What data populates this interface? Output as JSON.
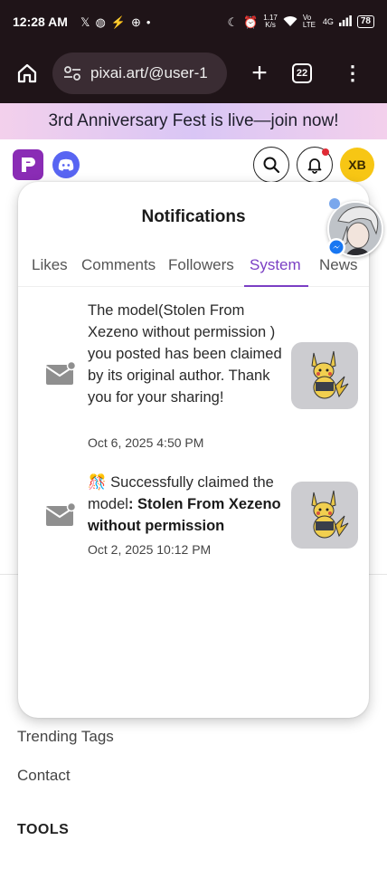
{
  "status_bar": {
    "time": "12:28 AM",
    "left_icons": [
      "x-app-icon",
      "messenger-icon",
      "signal-boost-icon",
      "dnd-icon",
      "dot-icon"
    ],
    "network_speed_top": "1.17",
    "network_speed_bottom": "K/s",
    "lte_label": "Vo LTE",
    "network_type": "4G",
    "battery": "78"
  },
  "browser": {
    "url": "pixai.art/@user-1",
    "tab_count": "22"
  },
  "banner": {
    "text": "3rd Anniversary Fest is live—join now!"
  },
  "header": {
    "avatar_initials": "XB",
    "brand_color": "#8a2cb5",
    "discord_color": "#5865f2"
  },
  "notifications": {
    "title": "Notifications",
    "tabs": [
      {
        "label": "Likes"
      },
      {
        "label": "Comments"
      },
      {
        "label": "Followers"
      },
      {
        "label": "System"
      },
      {
        "label": "News"
      }
    ],
    "active_tab": "System",
    "items": [
      {
        "text": "The model(Stolen From Xezeno without permission ) you posted has been claimed by its original author. Thank you for your sharing!",
        "date": "Oct 6, 2025 4:50 PM"
      },
      {
        "prefix_emoji": "🎊",
        "text_plain": " Successfully claimed the model",
        "text_bold": ": Stolen From Xezeno without permission",
        "date": "Oct 2, 2025 10:12 PM"
      }
    ]
  },
  "background_links": {
    "trending": "Trending Tags",
    "contact": "Contact",
    "tools": "TOOLS"
  }
}
